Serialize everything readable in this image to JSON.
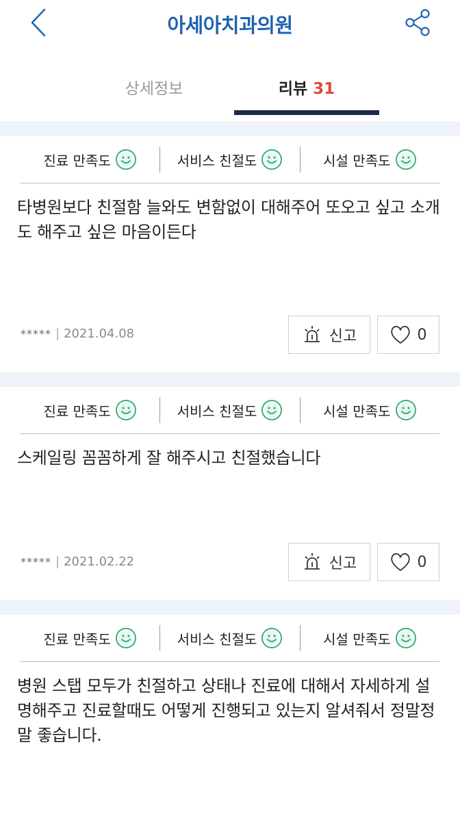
{
  "header": {
    "title": "아세아치과의원"
  },
  "tabs": [
    {
      "label": "상세정보",
      "count": ""
    },
    {
      "label": "리뷰",
      "count": "31"
    }
  ],
  "rating_labels": [
    "진료 만족도",
    "서비스 친절도",
    "시설 만족도"
  ],
  "reviews": [
    {
      "content": "타병원보다 친절함 늘와도 변함없이 대해주어 또오고 싶고 소개도 해주고 싶은 마음이든다",
      "author": "*****",
      "date": "2021.04.08",
      "report_label": "신고",
      "likes": "0"
    },
    {
      "content": "스케일링 꼼꼼하게 잘 해주시고 친절했습니다",
      "author": "*****",
      "date": "2021.02.22",
      "report_label": "신고",
      "likes": "0"
    },
    {
      "content": "병원 스탭 모두가 친절하고 상태나 진료에 대해서 자세하게 설명해주고 진료할때도 어떻게 진행되고 있는지 알셔줘서 정말정말 좋습니다."
    }
  ],
  "colors": {
    "title": "#1e63b0",
    "count": "#e0473c",
    "smiley": "#3ab07a",
    "separator": "#eef3f9"
  }
}
